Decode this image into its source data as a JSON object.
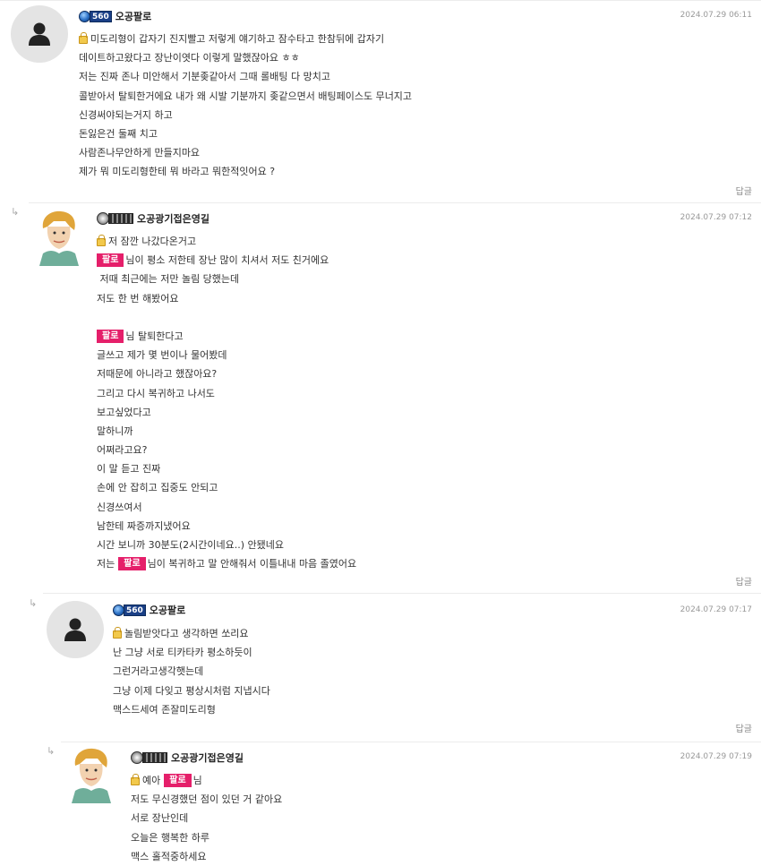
{
  "reply_label": "답글",
  "reply_arrow": "↳",
  "comments": [
    {
      "nickname": "오공팔로",
      "level_text": "560",
      "avatar": "person-icon",
      "date": "2024.07.29 06:11",
      "lines": [
        "미도리형이 갑자기 진지빨고 저렇게 얘기하고 잠수타고 한참뒤에 갑자기",
        "데이트하고왔다고 장난이엿다 이렇게 말했잖아요 ㅎㅎ",
        "저는 진짜 존나 미안해서 기분좆같아서 그때 롤배팅 다 망치고",
        "콜받아서 탈퇴한거에요 내가 왜 시발 기분까지 좆같으면서 배팅페이스도 무너지고",
        "신경써야되는거지 하고",
        "돈잃은건 둘째 치고",
        "사람존나무안하게 만들지마요",
        "제가 뭐 미도리형한테 뭐 바라고 뭐한적잇어요 ?"
      ]
    },
    {
      "nickname": "오공광기접은영길",
      "avatar": "cartoon-avatar",
      "date": "2024.07.29 07:12",
      "tag": "팔로",
      "lines": [
        "저 잠깐 나갔다온거고",
        "님이 평소 저한테 장난 많이 치셔서 저도 친거에요",
        " 저때 최근에는 저만 놀림 당했는데",
        "저도 한 번 해봤어요",
        "",
        "님 탈퇴한다고",
        "글쓰고 제가 몇 번이나 물어봤데",
        "저때문에 아니라고 했잖아요?",
        "그리고 다시 복귀하고 나서도",
        "보고싶었다고",
        "말하니까",
        "어쩌라고요?",
        "이 말 듣고 진짜",
        "손에 안 잡히고 집중도 안되고",
        "신경쓰여서",
        "남한테 짜증까지냈어요",
        "시간 보니까 30분도(2시간이네요..) 안됐네요",
        "님이 복귀하고 말 안해줘서 이틀내내 마음 졸였어요"
      ],
      "last_prefix": "저는"
    },
    {
      "nickname": "오공팔로",
      "level_text": "560",
      "avatar": "person-icon",
      "date": "2024.07.29 07:17",
      "lines": [
        "놀림받앗다고 생각하면 쏘리요",
        "난 그냥 서로 티카타카 평소하듯이",
        "그런거라고생각햇는데",
        "그냥 이제 다잊고 평상시처럼 지냅시다",
        "맥스드세여 존잘미도리형"
      ]
    },
    {
      "nickname": "오공광기접은영길",
      "avatar": "cartoon-avatar",
      "date": "2024.07.29 07:19",
      "tag": "팔로",
      "lines": [
        "예아",
        "님",
        "저도 무신경했던 점이 있던 거 같아요",
        "서로 장난인데",
        "오늘은 행복한 하루",
        "맥스 홀적중하세요"
      ]
    }
  ]
}
